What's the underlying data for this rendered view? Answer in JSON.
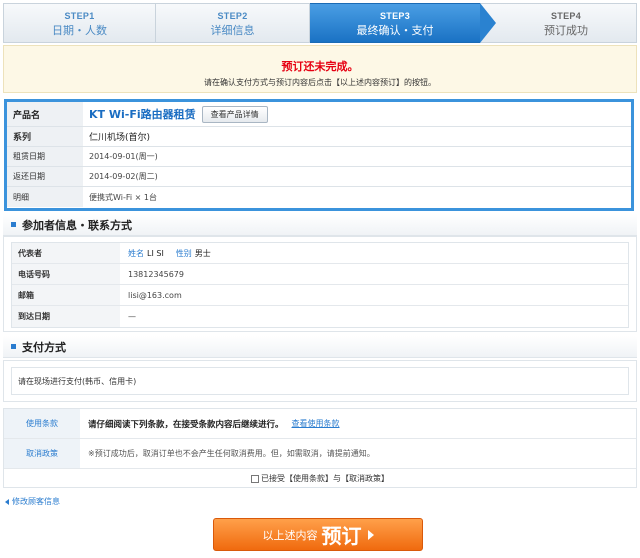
{
  "steps": [
    {
      "num": "STEP1",
      "label": "日期・人数"
    },
    {
      "num": "STEP2",
      "label": "详细信息"
    },
    {
      "num": "STEP3",
      "label": "最终确认・支付"
    },
    {
      "num": "STEP4",
      "label": "预订成功"
    }
  ],
  "notice": {
    "title": "预订还未完成。",
    "subtitle": "请在确认支付方式与预订内容后点击【以上述内容预订】的按钮。"
  },
  "product": {
    "name_label": "产品名",
    "name": "KT Wi-Fi路由器租赁",
    "detail_button": "查看产品详情",
    "series_label": "系列",
    "series": "仁川机场(首尔)",
    "rent_date_label": "租赁日期",
    "rent_date": "2014-09-01(周一)",
    "return_date_label": "返还日期",
    "return_date": "2014-09-02(周二)",
    "details_label": "明细",
    "details": "便携式Wi-Fi × 1台"
  },
  "participant": {
    "section_title": "参加者信息・联系方式",
    "rep_label": "代表者",
    "name_tag": "姓名",
    "name": "LI SI",
    "gender_tag": "性别",
    "gender": "男士",
    "phone_label": "电话号码",
    "phone": "13812345679",
    "email_label": "邮箱",
    "email": "lisi@163.com",
    "arrival_label": "到达日期",
    "arrival": "—"
  },
  "payment": {
    "section_title": "支付方式",
    "text": "请在现场进行支付(韩币、信用卡)"
  },
  "terms": {
    "terms_label": "使用条款",
    "terms_text": "请仔细阅读下列条款，在接受条款内容后继续进行。",
    "terms_link": "查看使用条款",
    "cancel_label": "取消政策",
    "cancel_text": "※预订成功后，取消订单也不会产生任何取消费用。但，如需取消，请提前通知。",
    "agree_text": "已接受【使用条款】与【取消政策】"
  },
  "back_link": "修改顾客信息",
  "submit": {
    "small": "以上述内容",
    "big": "预订"
  },
  "colors": {
    "accent": "#2a7ccf",
    "alert": "#e60012",
    "submit": "#f07a20"
  }
}
